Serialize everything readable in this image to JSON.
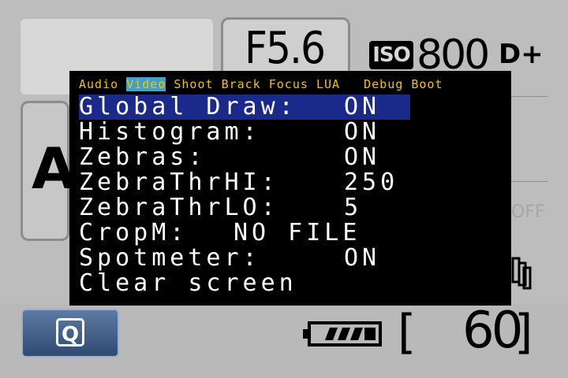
{
  "camera": {
    "mode": "A",
    "aperture": "F5.6",
    "iso_badge": "ISO",
    "iso_value": "800",
    "dplus": "D+",
    "off_label": "OFF",
    "q_label": "Q",
    "shots_open": "[",
    "shots_remaining": "60",
    "shots_close": "]"
  },
  "menu": {
    "tabs": [
      {
        "label": "Audio",
        "active": false
      },
      {
        "label": "Video",
        "active": true
      },
      {
        "label": "Shoot",
        "active": false
      },
      {
        "label": "Brack",
        "active": false
      },
      {
        "label": "Focus",
        "active": false
      },
      {
        "label": "LUA",
        "active": false
      },
      {
        "label": "Debug",
        "active": false
      },
      {
        "label": "Boot",
        "active": false
      }
    ],
    "items": [
      {
        "label": "Global Draw:",
        "value": "ON",
        "selected": true
      },
      {
        "label": "Histogram:",
        "value": "ON",
        "selected": false
      },
      {
        "label": "Zebras:",
        "value": "ON",
        "selected": false
      },
      {
        "label": "ZebraThrHI:",
        "value": "250",
        "selected": false
      },
      {
        "label": "ZebraThrLO:",
        "value": "5",
        "selected": false
      },
      {
        "label": "CropM:",
        "value": "NO FILE",
        "selected": false
      },
      {
        "label": "Spotmeter:",
        "value": "ON",
        "selected": false
      },
      {
        "label": "Clear screen",
        "value": "",
        "selected": false
      }
    ]
  },
  "colors": {
    "tab_text": "#f2c400",
    "tab_active_bg": "#43a0c8",
    "selected_row_bg": "#1b2a8a",
    "menu_bg": "#000000"
  }
}
